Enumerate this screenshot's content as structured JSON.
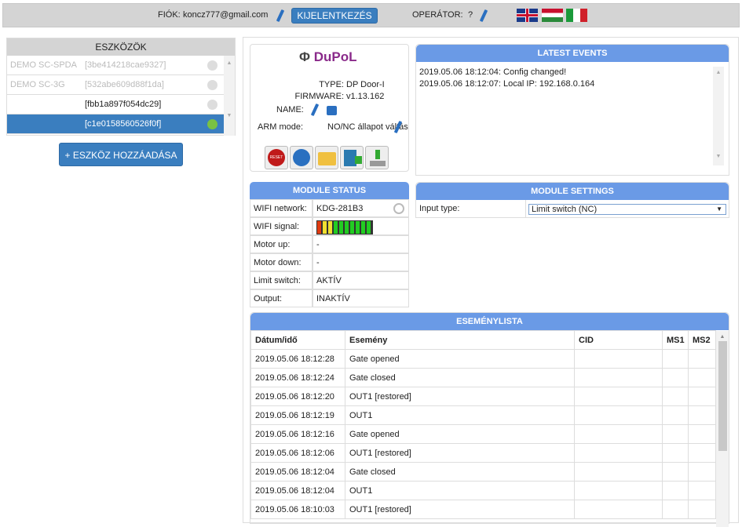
{
  "header": {
    "account_label": "FIÓK:",
    "account_email": "koncz777@gmail.com",
    "logout": "KIJELENTKEZÉS",
    "operator_label": "OPERÁTOR:",
    "operator_value": "?",
    "flags": [
      "en",
      "hu",
      "it"
    ]
  },
  "devices": {
    "title": "ESZKÖZÖK",
    "items": [
      {
        "name": "DEMO SC-SPDA",
        "id": "[3be414218cae9327]",
        "status": "inactive"
      },
      {
        "name": "DEMO SC-3G",
        "id": "[532abe609d88f1da]",
        "status": "inactive"
      },
      {
        "name": "",
        "id": "[fbb1a897f054dc29]",
        "status": "inactive"
      },
      {
        "name": "",
        "id": "[c1e0158560526f0f]",
        "status": "active",
        "selected": true
      }
    ],
    "add_button": "+ ESZKÖZ HOZZÁADÁSA"
  },
  "module": {
    "logo": "DuPoL",
    "type_label": "TYPE:",
    "type": "DP Door-I",
    "firmware_label": "FIRMWARE:",
    "firmware": "v1.13.162",
    "name_label": "NAME:",
    "arm_label": "ARM mode:",
    "arm": "NO/NC állapot váltás",
    "tools": [
      "reset-icon",
      "remote-icon",
      "folder-icon",
      "save-icon",
      "download-icon"
    ],
    "reset_text": "RESET"
  },
  "latest_events": {
    "title": "LATEST EVENTS",
    "items": [
      "2019.05.06 18:12:04: Config changed!",
      "2019.05.06 18:12:07: Local IP: 192.168.0.164"
    ]
  },
  "status": {
    "title": "MODULE STATUS",
    "rows": [
      {
        "label": "WIFI network:",
        "value": "KDG-281B3"
      },
      {
        "label": "WIFI signal:",
        "value": ""
      },
      {
        "label": "Motor up:",
        "value": "-"
      },
      {
        "label": "Motor down:",
        "value": "-"
      },
      {
        "label": "Limit switch:",
        "value": "AKTÍV"
      },
      {
        "label": "Output:",
        "value": "INAKTÍV"
      }
    ],
    "signal_bars": [
      "#e03a10",
      "#f0e030",
      "#f0e030",
      "#22cc22",
      "#22cc22",
      "#22cc22",
      "#22cc22",
      "#22cc22",
      "#22cc22",
      "#22cc22"
    ]
  },
  "settings": {
    "title": "MODULE SETTINGS",
    "input_label": "Input type:",
    "input_value": "Limit switch (NC)"
  },
  "eventlist": {
    "title": "ESEMÉNYLISTA",
    "columns": [
      "Dátum/idő",
      "Esemény",
      "CID",
      "MS1",
      "MS2"
    ],
    "rows": [
      [
        "2019.05.06 18:12:28",
        "Gate opened"
      ],
      [
        "2019.05.06 18:12:24",
        "Gate closed"
      ],
      [
        "2019.05.06 18:12:20",
        "OUT1 [restored]"
      ],
      [
        "2019.05.06 18:12:19",
        "OUT1"
      ],
      [
        "2019.05.06 18:12:16",
        "Gate opened"
      ],
      [
        "2019.05.06 18:12:06",
        "OUT1 [restored]"
      ],
      [
        "2019.05.06 18:12:04",
        "Gate closed"
      ],
      [
        "2019.05.06 18:12:04",
        "OUT1"
      ],
      [
        "2019.05.06 18:10:03",
        "OUT1 [restored]"
      ]
    ]
  }
}
